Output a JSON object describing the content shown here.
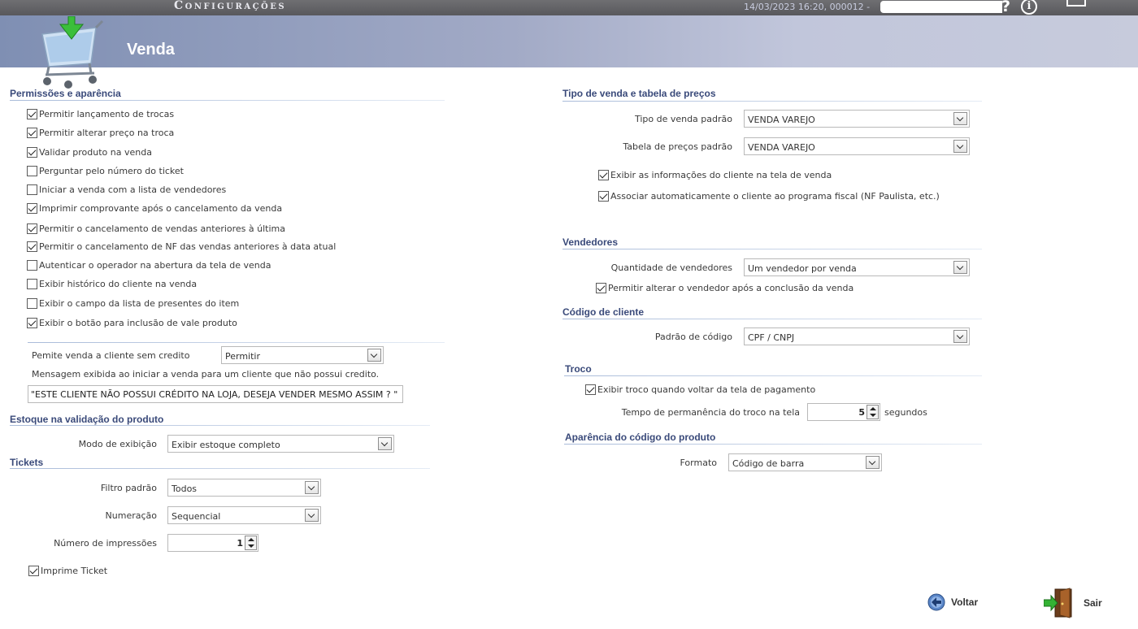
{
  "topbar": {
    "app_title": "Configurações",
    "datetime": "14/03/2023 16:20, 000012 -",
    "help": "?",
    "info": "i"
  },
  "header": {
    "title": "Venda"
  },
  "permissoes": {
    "title": "Permissões e aparência",
    "items": [
      {
        "label": "Permitir lançamento de trocas",
        "checked": true
      },
      {
        "label": "Permitir alterar preço na troca",
        "checked": true
      },
      {
        "label": "Validar produto na venda",
        "checked": true
      },
      {
        "label": "Perguntar pelo número do ticket",
        "checked": false
      },
      {
        "label": "Iniciar a venda com a lista de vendedores",
        "checked": false
      },
      {
        "label": "Imprimir comprovante após o cancelamento da venda",
        "checked": true
      },
      {
        "label": "Permitir o cancelamento de vendas anteriores à última",
        "checked": true
      },
      {
        "label": "Permitir o cancelamento de NF das vendas anteriores à data atual",
        "checked": true
      },
      {
        "label": "Autenticar o operador na abertura da tela de venda",
        "checked": false
      },
      {
        "label": "Exibir histórico do cliente na venda",
        "checked": false
      },
      {
        "label": "Exibir o campo da lista de presentes do item",
        "checked": false
      },
      {
        "label": "Exibir o botão para inclusão de vale produto",
        "checked": true
      }
    ],
    "credito_label": "Pemite venda a cliente sem credito",
    "credito_value": "Permitir",
    "mensagem_label": "Mensagem exibida ao iniciar a venda para um cliente que não possui credito.",
    "mensagem_value": "\"ESTE CLIENTE NÃO POSSUI CRÉDITO NA LOJA, DESEJA VENDER MESMO ASSIM ? \""
  },
  "estoque": {
    "title": "Estoque na validação do produto",
    "modo_label": "Modo de exibição",
    "modo_value": "Exibir estoque completo"
  },
  "tickets": {
    "title": "Tickets",
    "filtro_label": "Filtro padrão",
    "filtro_value": "Todos",
    "numeracao_label": "Numeração",
    "numeracao_value": "Sequencial",
    "impressoes_label": "Número de impressões",
    "impressoes_value": "1",
    "imprime_label": "Imprime Ticket",
    "imprime_checked": true
  },
  "tipo_venda": {
    "title": "Tipo de venda e tabela de preços",
    "tipo_label": "Tipo de venda padrão",
    "tipo_value": "VENDA VAREJO",
    "tabela_label": "Tabela de preços padrão",
    "tabela_value": "VENDA VAREJO",
    "exibir_label": "Exibir as informações do cliente na tela de venda",
    "exibir_checked": true,
    "associar_label": "Associar automaticamente o cliente ao programa fiscal (NF Paulista, etc.)",
    "associar_checked": true
  },
  "vendedores": {
    "title": "Vendedores",
    "qtd_label": "Quantidade de vendedores",
    "qtd_value": "Um vendedor por venda",
    "alterar_label": "Permitir alterar o vendedor após a conclusão da venda",
    "alterar_checked": true
  },
  "codigo_cliente": {
    "title": "Código de cliente",
    "padrao_label": "Padrão de código",
    "padrao_value": "CPF / CNPJ"
  },
  "troco": {
    "title": "Troco",
    "exibir_label": "Exibir troco quando voltar da tela de pagamento",
    "exibir_checked": true,
    "tempo_label": "Tempo de permanência do troco na tela",
    "tempo_value": "5",
    "tempo_unit": "segundos"
  },
  "aparencia": {
    "title": "Aparência do código do produto",
    "formato_label": "Formato",
    "formato_value": "Código de barra"
  },
  "footer": {
    "voltar": "Voltar",
    "sair": "Sair"
  }
}
